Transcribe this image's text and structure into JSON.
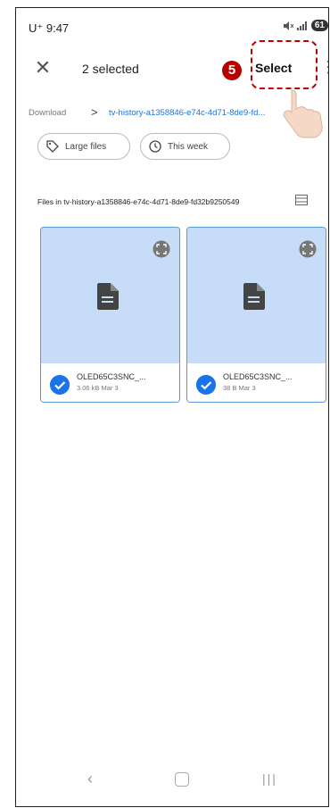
{
  "status_bar": {
    "time": "U⁺ 9:47",
    "battery": "61"
  },
  "app_bar": {
    "title": "2 selected",
    "select_label": "Select",
    "more": "⋮"
  },
  "annotation": {
    "step_number": "5",
    "highlight_color": "#c00000"
  },
  "breadcrumb": {
    "root": "Download",
    "separator": ">",
    "current": "tv-history-a1358846-e74c-4d71-8de9-fd..."
  },
  "filters": [
    {
      "label": "Large files",
      "icon": "tag-icon"
    },
    {
      "label": "This week",
      "icon": "history-icon"
    }
  ],
  "section": {
    "title": "Files in tv-history-a1358846-e74c-4d71-8de9-fd32b9250549"
  },
  "files": [
    {
      "name": "OLED65C3SNC_...",
      "meta": "3.06 kB  Mar 3",
      "selected": true
    },
    {
      "name": "OLED65C3SNC_...",
      "meta": "38 B  Mar 3",
      "selected": true
    }
  ],
  "colors": {
    "accent": "#1a73e8",
    "card_bg": "#d3e3fa"
  }
}
